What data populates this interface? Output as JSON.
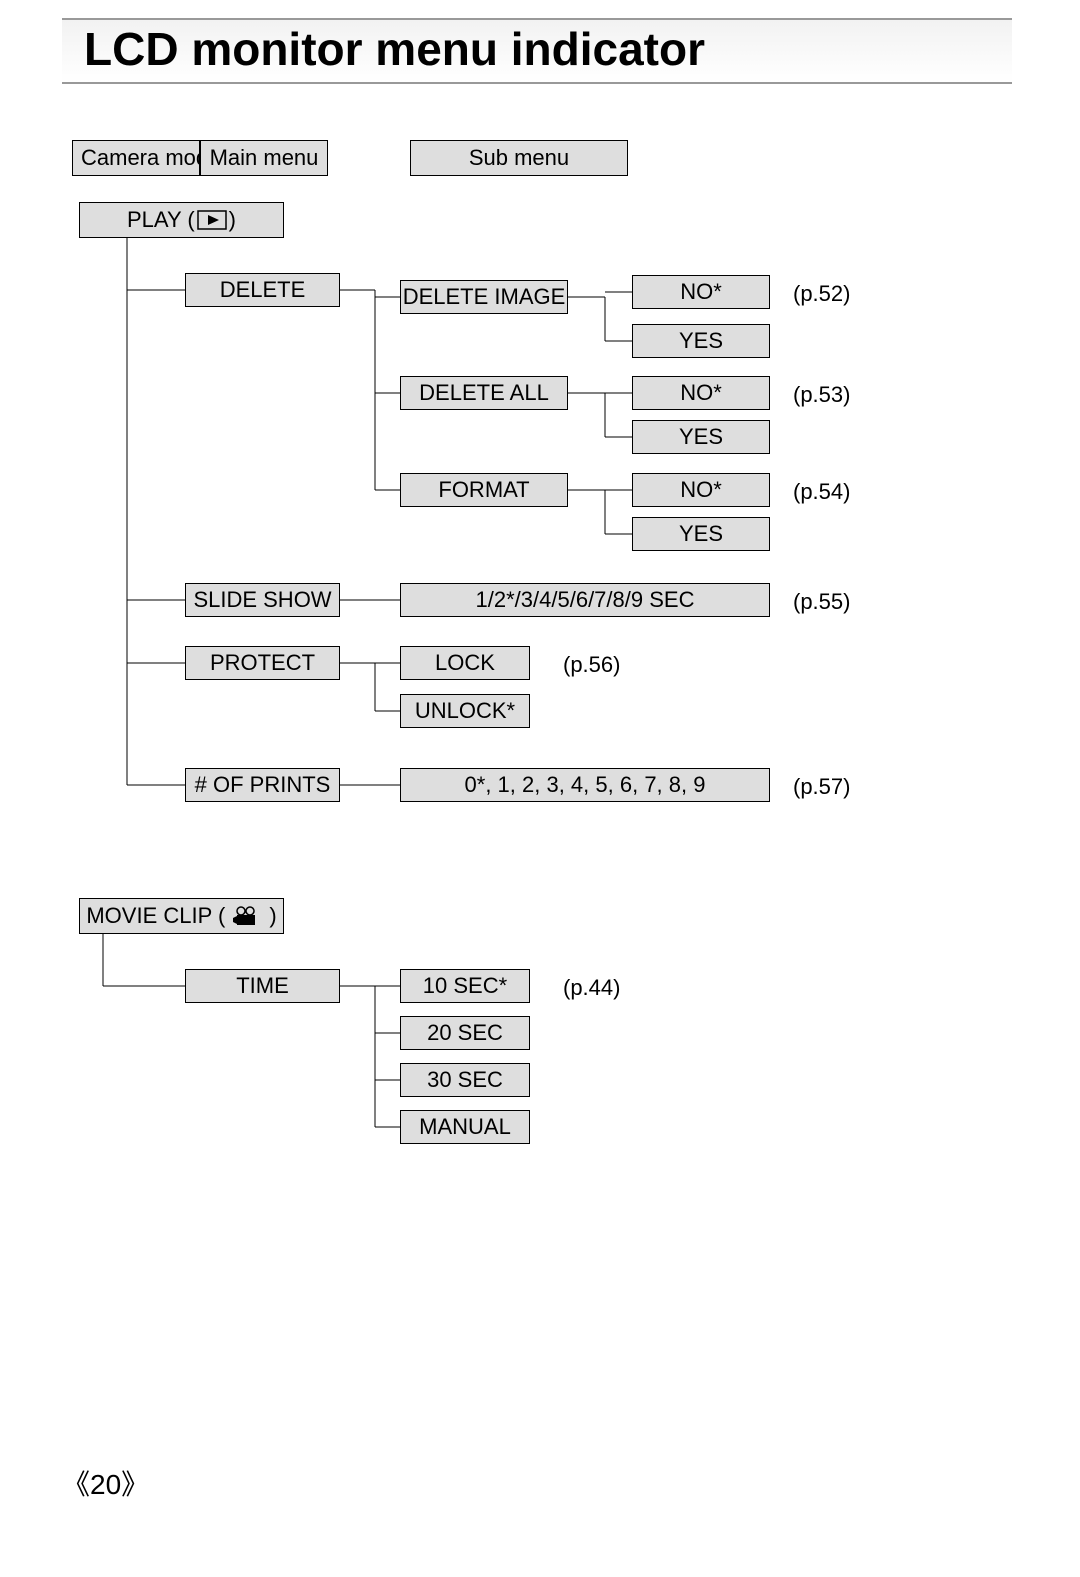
{
  "title": "LCD monitor menu indicator",
  "headers": {
    "camera_mode": "Camera mode",
    "main_menu": "Main menu",
    "sub_menu": "Sub menu"
  },
  "play_label": "PLAY (",
  "play_label_end": ")",
  "movie_label": "MOVIE CLIP (",
  "movie_label_end": ")",
  "menu": {
    "delete": "DELETE",
    "delete_image": "DELETE IMAGE",
    "delete_all": "DELETE ALL",
    "format": "FORMAT",
    "slide_show": "SLIDE SHOW",
    "slide_show_vals": "1/2*/3/4/5/6/7/8/9 SEC",
    "protect": "PROTECT",
    "lock": "LOCK",
    "unlock": "UNLOCK*",
    "prints": "# OF PRINTS",
    "prints_vals": "0*, 1, 2, 3, 4, 5, 6, 7, 8, 9",
    "time": "TIME",
    "t10": "10 SEC*",
    "t20": "20 SEC",
    "t30": "30 SEC",
    "tmanual": "MANUAL",
    "no": "NO*",
    "yes": "YES"
  },
  "pages": {
    "p52": "(p.52)",
    "p53": "(p.53)",
    "p54": "(p.54)",
    "p55": "(p.55)",
    "p56": "(p.56)",
    "p57": "(p.57)",
    "p44": "(p.44)"
  },
  "page_number": "20"
}
